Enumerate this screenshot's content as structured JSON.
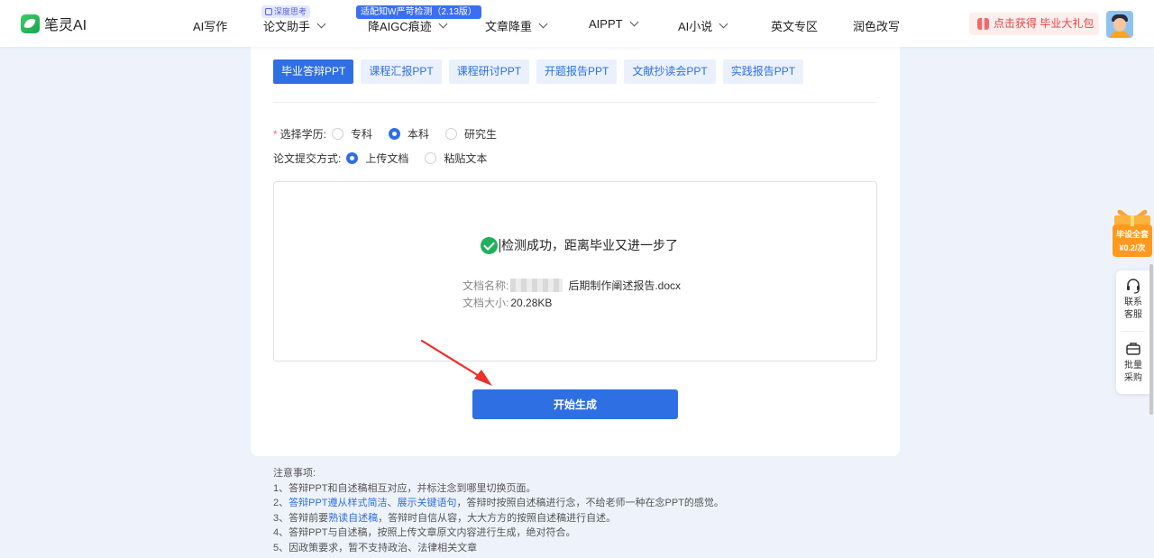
{
  "header": {
    "logo_text": "笔灵AI",
    "nav": [
      {
        "label": "AI写作"
      },
      {
        "label": "论文助手",
        "badge": "深度思考"
      },
      {
        "label": "降AIGC痕迹",
        "badge": "适配知W严苛检测（2.13版）"
      },
      {
        "label": "文章降重"
      },
      {
        "label": "AIPPT"
      },
      {
        "label": "AI小说"
      },
      {
        "label": "英文专区"
      },
      {
        "label": "润色改写"
      }
    ],
    "promo": "点击获得 毕业大礼包"
  },
  "tabs": [
    "毕业答辩PPT",
    "课程汇报PPT",
    "课程研讨PPT",
    "开题报告PPT",
    "文献抄读会PPT",
    "实践报告PPT"
  ],
  "form": {
    "education_label": "选择学历:",
    "education_options": [
      "专科",
      "本科",
      "研究生"
    ],
    "education_selected": "本科",
    "submit_label": "论文提交方式:",
    "submit_options": [
      "上传文档",
      "粘贴文本"
    ],
    "submit_selected": "上传文档"
  },
  "upload": {
    "success_text": "检测成功，距离毕业又进一步了",
    "name_label": "文档名称:",
    "name_value": "后期制作阐述报告.docx",
    "size_label": "文档大小:",
    "size_value": "20.28KB"
  },
  "start_button": "开始生成",
  "notes": {
    "title": "注意事项:",
    "line1": "1、答辩PPT和自述稿相互对应，并标注念到哪里切换页面。",
    "line2_pre": "2、",
    "line2_hl1": "答辩PPT遵从样式简洁",
    "line2_sep": "、",
    "line2_hl2": "展示关键语句",
    "line2_post": "，答辩时按照自述稿进行念，不给老师一种在念PPT的感觉。",
    "line3_pre": "3、答辩前要",
    "line3_hl": "熟读自述稿",
    "line3_post": "，答辩时自信从容，大大方方的按照自述稿进行自述。",
    "line4": "4、答辩PPT与自述稿，按照上传文章原文内容进行生成，绝对符合。",
    "line5": "5、因政策要求，暂不支持政治、法律相关文章"
  },
  "side": {
    "gift_line1": "毕设全套",
    "gift_line2": "¥0.2/次",
    "service": "联系客服",
    "bulk": "批量采购"
  },
  "colors": {
    "accent": "#2f6fe4",
    "success": "#21b05c",
    "promo": "#e0463e"
  }
}
